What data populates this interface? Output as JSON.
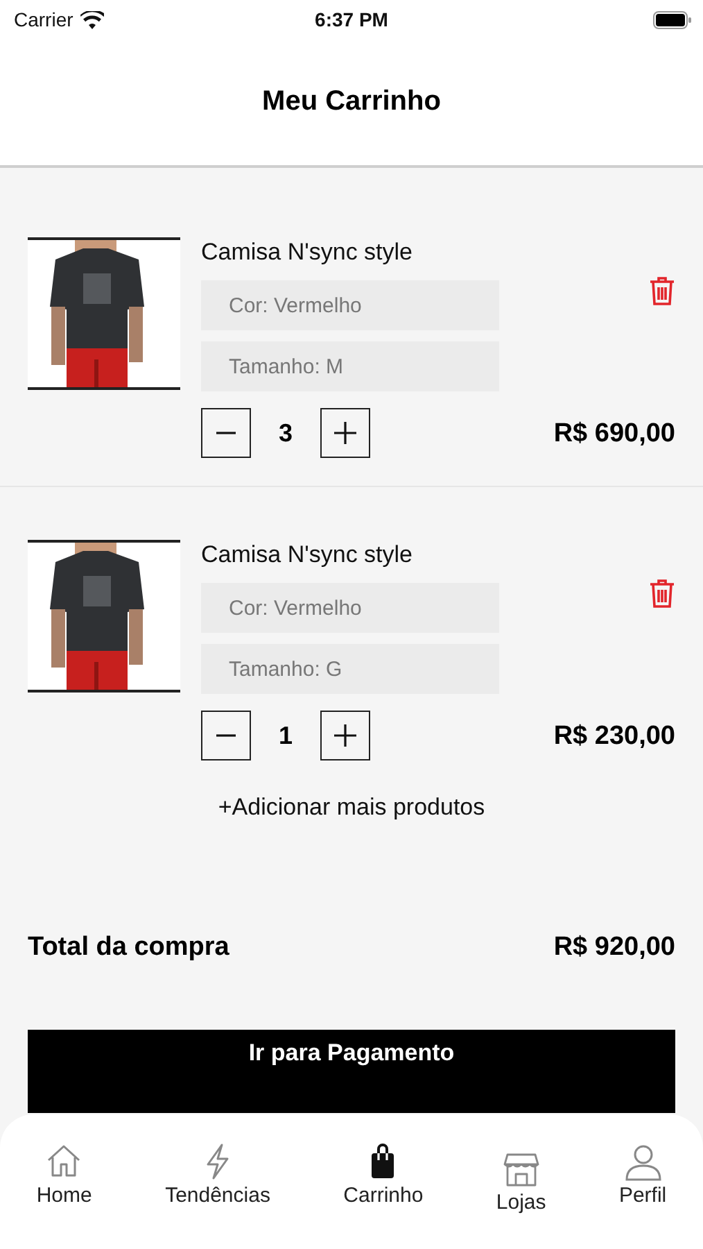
{
  "status_bar": {
    "carrier": "Carrier",
    "time": "6:37 PM"
  },
  "header": {
    "title": "Meu Carrinho"
  },
  "cart_items": [
    {
      "name": "Camisa N'sync style",
      "color_field": {
        "placeholder": "Cor: Vermelho"
      },
      "size_field": {
        "placeholder": "Tamanho: M"
      },
      "quantity": "3",
      "price": "R$ 690,00"
    },
    {
      "name": "Camisa N'sync style",
      "color_field": {
        "placeholder": "Cor: Vermelho"
      },
      "size_field": {
        "placeholder": "Tamanho: G"
      },
      "quantity": "1",
      "price": "R$ 230,00"
    }
  ],
  "add_more_link": "+Adicionar mais produtos",
  "total": {
    "label": "Total da compra",
    "value": "R$ 920,00"
  },
  "checkout_button": "Ir para Pagamento",
  "tab_bar": [
    {
      "label": "Home",
      "selected": false
    },
    {
      "label": "Tendências",
      "selected": false
    },
    {
      "label": "Carrinho",
      "selected": true
    },
    {
      "label": "Lojas",
      "selected": false
    },
    {
      "label": "Perfil",
      "selected": false
    }
  ]
}
